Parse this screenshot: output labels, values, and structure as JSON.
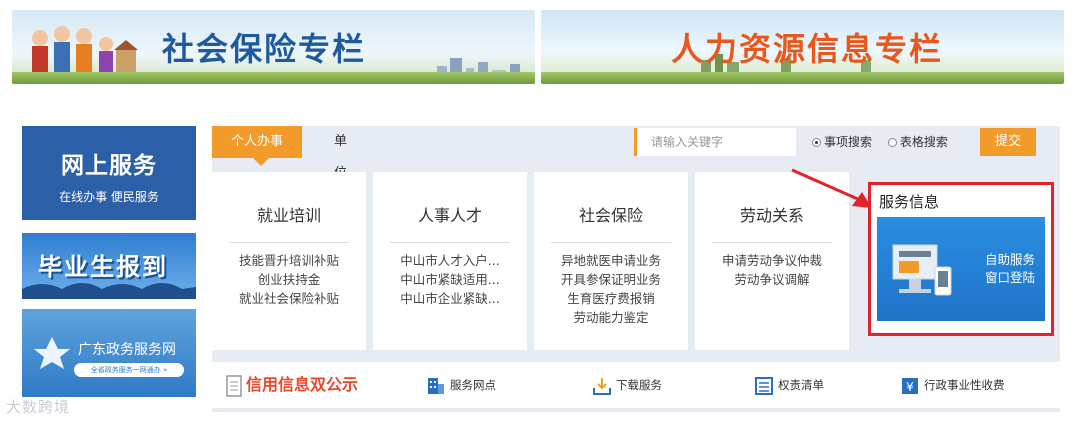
{
  "banners": {
    "left_title": "社会保险专栏",
    "right_title": "人力资源信息专栏"
  },
  "sidebar": {
    "online_title": "网上服务",
    "online_sub": "在线办事 便民服务",
    "graduate_title": "毕业生报到",
    "gov_title": "广东政务服务网",
    "gov_sub": "全省政务服务一网通办 »"
  },
  "tabs": {
    "active": "个人办事",
    "other": "单位办事"
  },
  "search": {
    "placeholder": "请输入关键字",
    "options": [
      "事项搜索",
      "表格搜索"
    ],
    "selected": "事项搜索",
    "submit": "提交"
  },
  "cards": [
    {
      "title": "就业培训",
      "items": [
        "技能晋升培训补贴",
        "创业扶持金",
        "就业社会保险补贴"
      ]
    },
    {
      "title": "人事人才",
      "items": [
        "中山市人才入户...",
        "中山市紧缺适用...",
        "中山市企业紧缺..."
      ]
    },
    {
      "title": "社会保险",
      "items": [
        "异地就医申请业务",
        "开具参保证明业务",
        "生育医疗费报销",
        "劳动能力鉴定"
      ]
    },
    {
      "title": "劳动关系",
      "items": [
        "申请劳动争议仲裁",
        "劳动争议调解"
      ]
    }
  ],
  "service": {
    "title": "服务信息",
    "label_line1": "自助服务",
    "label_line2": "窗口登陆"
  },
  "bottom_bar": {
    "credit": "信用信息双公示",
    "items": [
      "服务网点",
      "下载服务",
      "权责清单",
      "行政事业性收费"
    ]
  },
  "watermark": "大数跨境",
  "colors": {
    "accent_orange": "#f39b2a",
    "primary_blue": "#2b5fa7",
    "highlight_red": "#e3232b"
  }
}
